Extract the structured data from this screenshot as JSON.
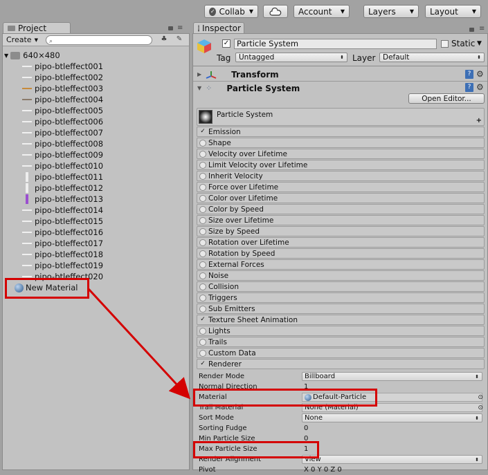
{
  "toolbar": {
    "collab": "Collab",
    "cloud": "cloud-icon",
    "account": "Account",
    "layers": "Layers",
    "layout": "Layout"
  },
  "project": {
    "tab": "Project",
    "create": "Create",
    "root": "640×480",
    "items": [
      "pipo-btleffect001",
      "pipo-btleffect002",
      "pipo-btleffect003",
      "pipo-btleffect004",
      "pipo-btleffect005",
      "pipo-btleffect006",
      "pipo-btleffect007",
      "pipo-btleffect008",
      "pipo-btleffect009",
      "pipo-btleffect010",
      "pipo-btleffect011",
      "pipo-btleffect012",
      "pipo-btleffect013",
      "pipo-btleffect014",
      "pipo-btleffect015",
      "pipo-btleffect016",
      "pipo-btleffect017",
      "pipo-btleffect018",
      "pipo-btleffect019",
      "pipo-btleffect020"
    ],
    "material": "New Material"
  },
  "inspector": {
    "tab": "Inspector",
    "object_name": "Particle System",
    "static": "Static",
    "tag_label": "Tag",
    "tag_value": "Untagged",
    "layer_label": "Layer",
    "layer_value": "Default",
    "transform": "Transform",
    "ps_component": "Particle System",
    "open_editor": "Open Editor...",
    "ps_header": "Particle System",
    "modules": [
      {
        "name": "Emission",
        "on": true
      },
      {
        "name": "Shape",
        "on": false
      },
      {
        "name": "Velocity over Lifetime",
        "on": false
      },
      {
        "name": "Limit Velocity over Lifetime",
        "on": false
      },
      {
        "name": "Inherit Velocity",
        "on": false
      },
      {
        "name": "Force over Lifetime",
        "on": false
      },
      {
        "name": "Color over Lifetime",
        "on": false
      },
      {
        "name": "Color by Speed",
        "on": false
      },
      {
        "name": "Size over Lifetime",
        "on": false
      },
      {
        "name": "Size by Speed",
        "on": false
      },
      {
        "name": "Rotation over Lifetime",
        "on": false
      },
      {
        "name": "Rotation by Speed",
        "on": false
      },
      {
        "name": "External Forces",
        "on": false
      },
      {
        "name": "Noise",
        "on": false
      },
      {
        "name": "Collision",
        "on": false
      },
      {
        "name": "Triggers",
        "on": false
      },
      {
        "name": "Sub Emitters",
        "on": false
      },
      {
        "name": "Texture Sheet Animation",
        "on": true
      },
      {
        "name": "Lights",
        "on": false
      },
      {
        "name": "Trails",
        "on": false
      },
      {
        "name": "Custom Data",
        "on": false
      },
      {
        "name": "Renderer",
        "on": true
      }
    ],
    "renderer_props": [
      {
        "label": "Render Mode",
        "value": "Billboard",
        "kind": "dropdown"
      },
      {
        "label": "Normal Direction",
        "value": "1",
        "kind": "number"
      },
      {
        "label": "Material",
        "value": "Default-Particle",
        "kind": "object"
      },
      {
        "label": "Trail Material",
        "value": "None (Material)",
        "kind": "object"
      },
      {
        "label": "Sort Mode",
        "value": "None",
        "kind": "dropdown"
      },
      {
        "label": "Sorting Fudge",
        "value": "0",
        "kind": "number"
      },
      {
        "label": "Min Particle Size",
        "value": "0",
        "kind": "number"
      },
      {
        "label": "Max Particle Size",
        "value": "1",
        "kind": "number"
      },
      {
        "label": "Render Alignment",
        "value": "View",
        "kind": "dropdown"
      },
      {
        "label": "Pivot",
        "value": "X 0   Y 0   Z 0",
        "kind": "vector"
      }
    ]
  }
}
